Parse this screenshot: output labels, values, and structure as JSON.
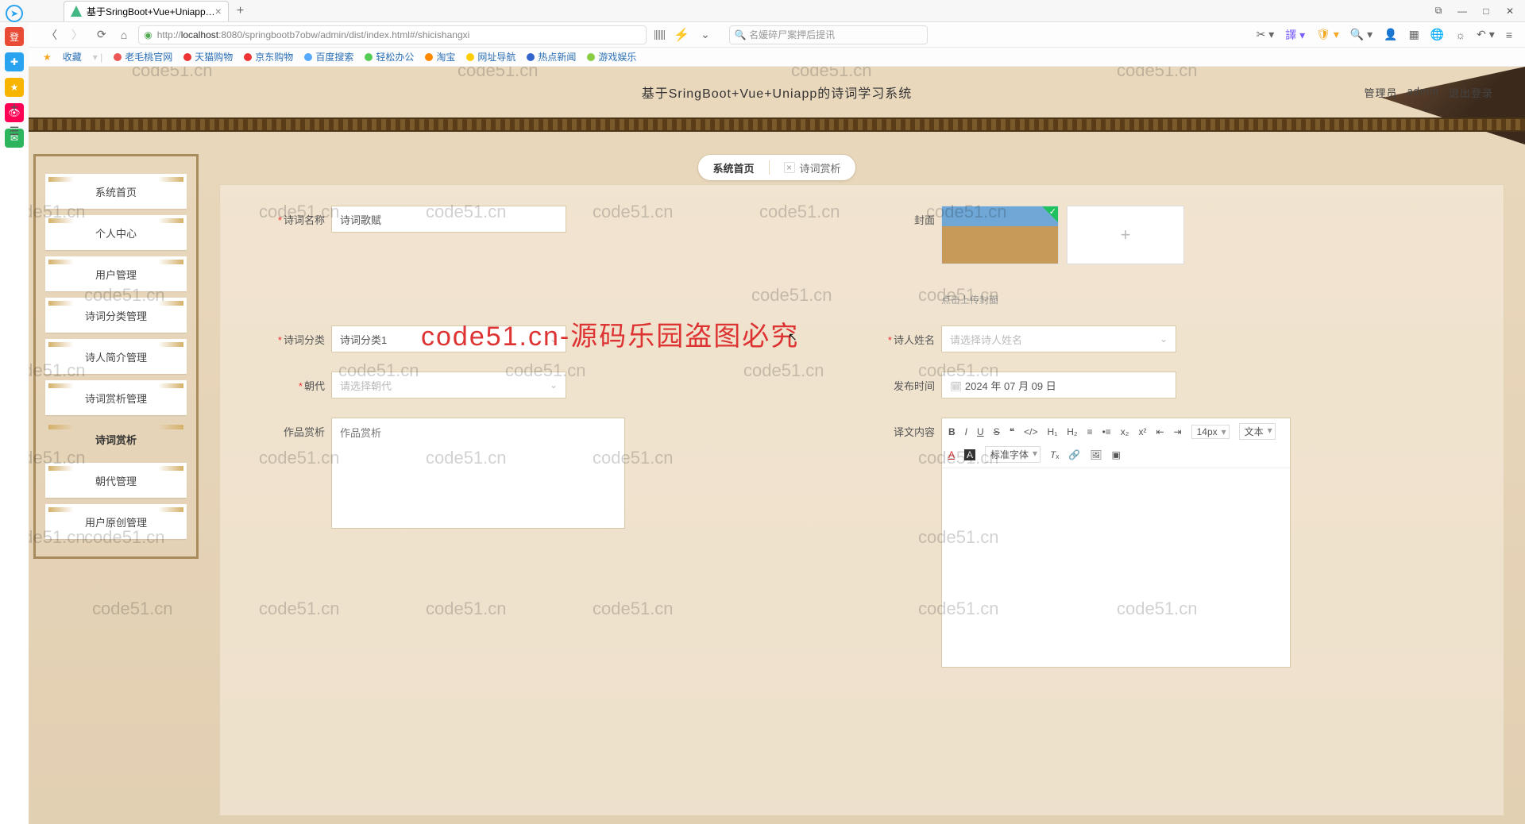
{
  "browser": {
    "tab_title": "基于SringBoot+Vue+Uniapp…",
    "url_prefix": "http://",
    "url_host": "localhost",
    "url_rest": ":8080/springbootb7obw/admin/dist/index.html#/shicishangxi",
    "search_placeholder": "名媛碎尸案押后提讯",
    "bookmarks_label": "收藏",
    "bookmarks": [
      "老毛桃官网",
      "天猫购物",
      "京东购物",
      "百度搜索",
      "轻松办公",
      "淘宝",
      "网址导航",
      "热点新闻",
      "游戏娱乐"
    ]
  },
  "app": {
    "title": "基于SringBoot+Vue+Uniapp的诗词学习系统",
    "role": "管理员",
    "user": "admin",
    "logout": "退出登录"
  },
  "tabs": {
    "home": "系统首页",
    "current": "诗词赏析"
  },
  "sidebar": {
    "items": [
      "系统首页",
      "个人中心",
      "用户管理",
      "诗词分类管理",
      "诗人简介管理",
      "诗词赏析管理",
      "诗词赏析",
      "朝代管理",
      "用户原创管理"
    ]
  },
  "form": {
    "name_label": "诗词名称",
    "name_value": "诗词歌赋",
    "cover_label": "封面",
    "cover_hint": "点击上传封面",
    "category_label": "诗词分类",
    "category_value": "诗词分类1",
    "poet_label": "诗人姓名",
    "poet_placeholder": "请选择诗人姓名",
    "dynasty_label": "朝代",
    "dynasty_placeholder": "请选择朝代",
    "pubtime_label": "发布时间",
    "pubtime_value": "2024 年 07 月 09 日",
    "appreciation_label": "作品赏析",
    "appreciation_placeholder": "作品赏析",
    "translation_label": "译文内容"
  },
  "rte": {
    "fontsize": "14px",
    "font_label": "文本",
    "fontfamily": "标准字体"
  },
  "watermark_text": "code51.cn",
  "big_watermark": "code51.cn-源码乐园盗图必究"
}
